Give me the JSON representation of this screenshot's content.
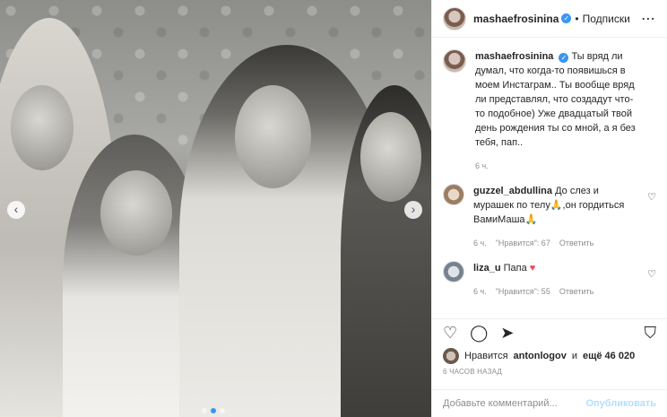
{
  "post": {
    "username": "mashaefrosinina",
    "follow_label": "Подписки",
    "separator": "•",
    "more_icon": "ellipsis-icon",
    "caption": "Ты вряд ли думал, что когда-то появишься в моем Инстаграм.. Ты вообще вряд ли представлял, что создадут что-то подобное) Уже двадцатый твой день рождения ты со мной, а я без тебя, пап..",
    "caption_age": "6 ч."
  },
  "comments": [
    {
      "username": "guzzel_abdullina",
      "text": "До слез и мурашек по телу🙏,он гордиться ВамиМаша🙏",
      "age": "6 ч.",
      "likes": "\"Нравится\": 67",
      "reply": "Ответить"
    },
    {
      "username": "liza_u",
      "text": "Папа ",
      "emoji": "♥",
      "age": "6 ч.",
      "likes": "\"Нравится\": 55",
      "reply": "Ответить"
    }
  ],
  "likes": {
    "prefix": "Нравится",
    "user": "antonlogov",
    "middle": "и",
    "count": "ещё 46 020"
  },
  "timestamp": "6 ЧАСОВ НАЗАД",
  "add_comment": {
    "placeholder": "Добавьте комментарий...",
    "publish": "Опубликовать"
  },
  "icons": {
    "like": "heart-icon",
    "comment": "comment-icon",
    "share": "share-icon",
    "save": "bookmark-icon"
  },
  "colors": {
    "accent": "#3897f0",
    "publish_disabled": "#b2dffc",
    "heart": "#ed4956"
  }
}
